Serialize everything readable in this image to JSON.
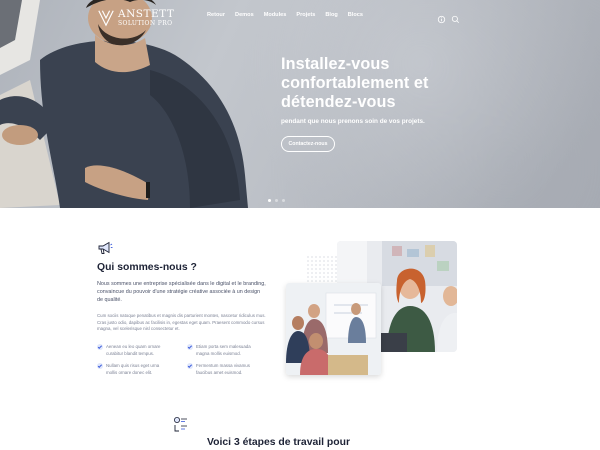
{
  "brand": {
    "name": "ANSTETT",
    "tagline": "SOLUTION PRO"
  },
  "nav": {
    "items": [
      {
        "label": "Retour"
      },
      {
        "label": "Demos"
      },
      {
        "label": "Modules"
      },
      {
        "label": "Projets"
      },
      {
        "label": "Blog"
      },
      {
        "label": "Blocs"
      }
    ]
  },
  "hero": {
    "title": "Installez-vous confortablement et détendez-vous",
    "subtitle": "pendant que nous prenons soin de vos projets.",
    "cta": "Contactez-nous"
  },
  "about": {
    "title": "Qui sommes-nous ?",
    "intro": "Nous sommes une entreprise spécialisée dans le digital et le branding, convaincue du pouvoir d'une stratégie créative associée à un design de qualité.",
    "body": "Cum sociis natoque penatibus et magnis dis parturient montes, nascetur ridiculus mus. Cras justo odio, dapibus ac facilisis in, egestas eget quam. Praesent commodo cursus magna, vel scelerisque nisl consectetur et.",
    "features": [
      "Aenean eu leo quam ornare curabitur blandit tempus.",
      "Etiam porta sem malesuada magna mollis euismod.",
      "Nullam quis risus eget urna mollis ornare donec elit.",
      "Fermentum massa vivamus faucibus amet euismod."
    ]
  },
  "steps": {
    "title": "Voici 3 étapes de travail pour"
  },
  "colors": {
    "accent": "#3b5bdb",
    "heading": "#1e2336",
    "text": "#4a5168",
    "muted": "#7b8194"
  }
}
